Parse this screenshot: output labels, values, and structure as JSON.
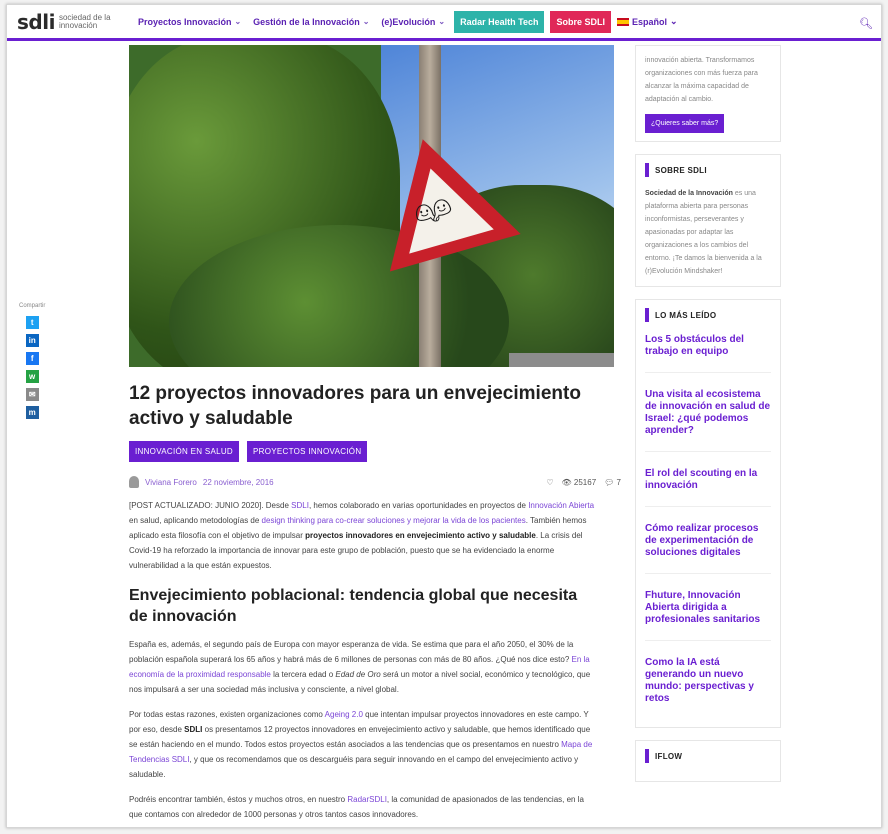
{
  "header": {
    "logo_mark": "sdli",
    "logo_text": "sociedad de la innovación",
    "nav": [
      {
        "label": "Proyectos Innovación"
      },
      {
        "label": "Gestión de la Innovación"
      },
      {
        "label": "(e)Evolución"
      }
    ],
    "radar_label": "Radar Health Tech",
    "sobre_label": "Sobre SDLI",
    "lang_label": "Español"
  },
  "share": {
    "label": "Compartir",
    "buttons": [
      {
        "name": "twitter",
        "glyph": "t",
        "color": "#1da1f2"
      },
      {
        "name": "linkedin",
        "glyph": "in",
        "color": "#0a66c2"
      },
      {
        "name": "facebook",
        "glyph": "f",
        "color": "#1877f2"
      },
      {
        "name": "whatsapp",
        "glyph": "w",
        "color": "#25a244"
      },
      {
        "name": "email",
        "glyph": "✉",
        "color": "#8a8a8a"
      },
      {
        "name": "meneame",
        "glyph": "m",
        "color": "#1f5fa0"
      }
    ]
  },
  "article": {
    "title": "12 proyectos innovadores para un envejecimiento activo y saludable",
    "tags": [
      "INNOVACIÓN EN SALUD",
      "PROYECTOS INNOVACIÓN"
    ],
    "author": "Viviana Forero",
    "date": "22 noviembre, 2016",
    "views": "25167",
    "comments": "7",
    "p1_a": "[POST ACTUALIZADO: JUNIO 2020]. Desde ",
    "p1_sdli": "SDLI",
    "p1_b": ", hemos colaborado en varias oportunidades en proyectos de ",
    "p1_link1": "Innovación Abierta",
    "p1_c": " en salud, aplicando metodologías de ",
    "p1_link2": "design thinking para co-crear soluciones y mejorar la vida de los pacientes",
    "p1_d": ". También hemos aplicado esta filosofía con el objetivo de impulsar ",
    "p1_bold": "proyectos innovadores en envejecimiento activo y saludable",
    "p1_e": ". La crisis del Covid-19 ha reforzado la importancia de innovar para este grupo de población, puesto que se ha evidenciado la enorme vulnerabilidad a la que están expuestos.",
    "h2": "Envejecimiento poblacional: tendencia global que necesita de innovación",
    "p2_a": "España es, además, el segundo país de Europa con mayor esperanza de vida. Se estima que para el año 2050, el 30% de la población española superará los 65 años y habrá más de 6 millones de personas con más de 80 años. ¿Qué nos dice esto? ",
    "p2_link": "En la economía de la proximidad responsable",
    "p2_b": " la tercera edad o ",
    "p2_italic": "Edad de Oro",
    "p2_c": " será un motor a nivel social, económico y tecnológico, que nos impulsará a ser una sociedad más inclusiva y consciente, a nivel global.",
    "p3_a": "Por todas estas razones, existen organizaciones como ",
    "p3_link1": "Ageing 2.0",
    "p3_b": " que intentan impulsar proyectos innovadores en este campo. Y por eso, desde ",
    "p3_sdli": "SDLI",
    "p3_c": " os presentamos 12 proyectos innovadores en envejecimiento activo y saludable, que hemos identificado que se están haciendo en el mundo. Todos estos proyectos están asociados a las tendencias que os presentamos en nuestro ",
    "p3_link2": "Mapa de Tendencias SDLI",
    "p3_d": ", y que os recomendamos que os descarguéis para seguir innovando en el campo del envejecimiento activo y saludable.",
    "p4_a": "Podréis encontrar también, éstos y muchos otros, en nuestro ",
    "p4_link": "RadarSDLI",
    "p4_b": ", la comunidad de apasionados de las tendencias, en la que contamos con alrededor de 1000 personas y otros tantos casos innovadores."
  },
  "sidebar": {
    "promo_text": "innovación abierta. Transformamos organizaciones con más fuerza para alcanzar la máxima capacidad de adaptación al cambio.",
    "promo_button": "¿Quieres saber más?",
    "about_title": "SOBRE SDLI",
    "about_bold": "Sociedad de la Innovación",
    "about_text": " es una plataforma abierta para personas inconformistas, perseverantes y apasionadas por adaptar las organizaciones a los cambios del entorno. ¡Te damos la bienvenida a la (r)Evolución Mindshaker!",
    "most_read_title": "LO MÁS LEÍDO",
    "most_read": [
      "Los 5 obstáculos del trabajo en equipo",
      "Una visita al ecosistema de innovación en salud de Israel: ¿qué podemos aprender?",
      "El rol del scouting en la innovación",
      "Cómo realizar procesos de experimentación de soluciones digitales",
      "Fhuture, Innovación Abierta dirigida a profesionales sanitarios",
      "Como la IA está generando un nuevo mundo: perspectivas y retos"
    ],
    "iflow_title": "IFLOW"
  }
}
